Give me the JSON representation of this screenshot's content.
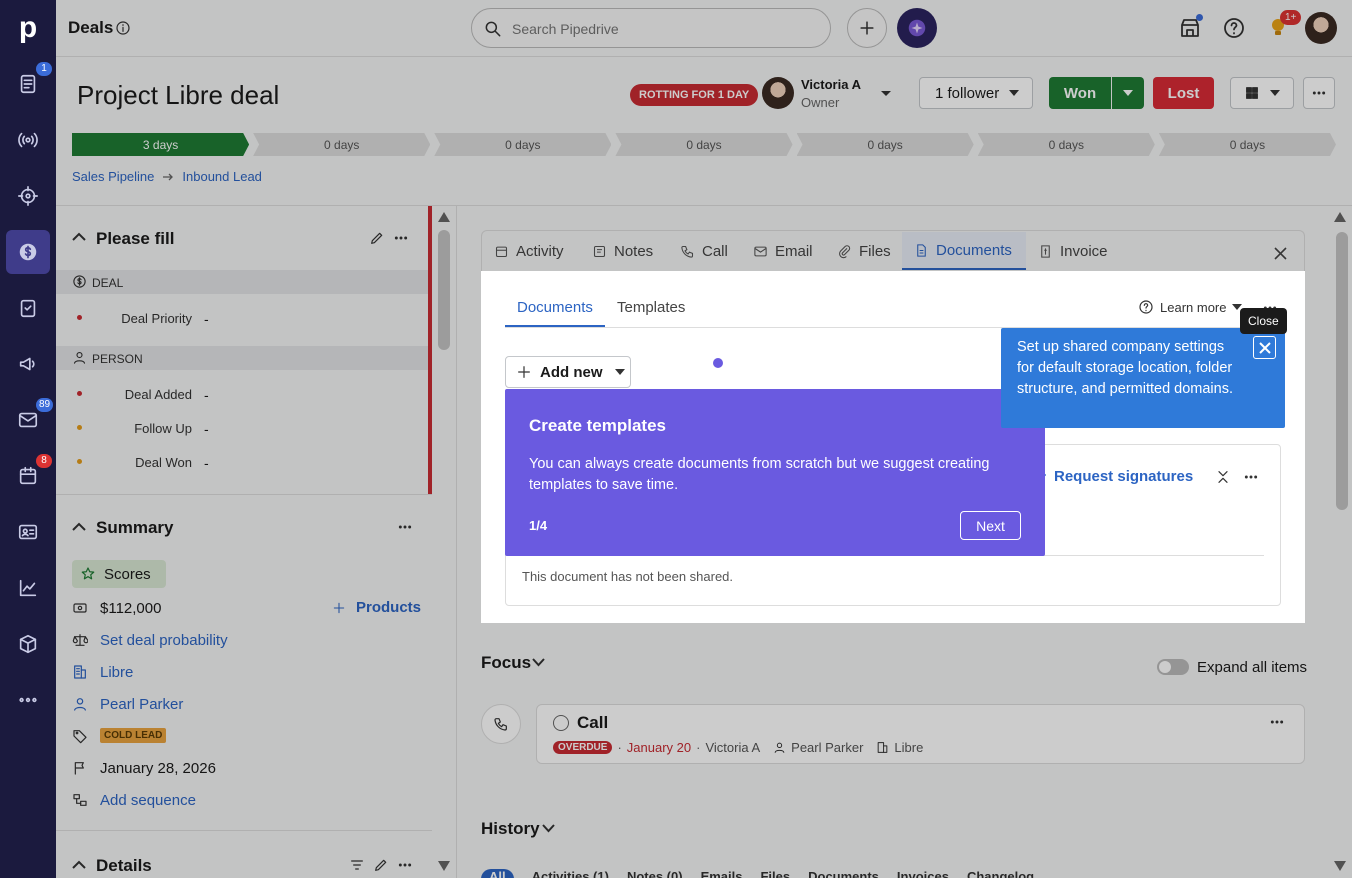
{
  "app": {
    "logo": "p",
    "page_title": "Deals",
    "search_placeholder": "Search Pipedrive",
    "notif_count": "1+"
  },
  "rail": {
    "badges": {
      "leads": "1",
      "mail": "89",
      "activities": "8"
    }
  },
  "deal": {
    "title": "Project Libre deal",
    "rotting": "ROTTING FOR 1 DAY",
    "owner_name": "Victoria A",
    "owner_role": "Owner",
    "followers": "1 follower",
    "won": "Won",
    "lost": "Lost"
  },
  "stages": [
    "3 days",
    "0 days",
    "0 days",
    "0 days",
    "0 days",
    "0 days",
    "0 days"
  ],
  "breadcrumb": {
    "pipeline": "Sales Pipeline",
    "stage": "Inbound Lead"
  },
  "please_fill": {
    "title": "Please fill",
    "deal_header": "DEAL",
    "person_header": "PERSON",
    "fields": [
      {
        "label": "Deal Priority",
        "value": "-"
      },
      {
        "label": "Deal Added",
        "value": "-"
      },
      {
        "label": "Follow Up",
        "value": "-"
      },
      {
        "label": "Deal Won",
        "value": "-"
      }
    ]
  },
  "summary": {
    "title": "Summary",
    "scores": "Scores",
    "value": "$112,000",
    "products": "Products",
    "probability": "Set deal probability",
    "org": "Libre",
    "person": "Pearl Parker",
    "label": "COLD LEAD",
    "close_date": "January 28, 2026",
    "sequence": "Add sequence"
  },
  "details": {
    "title": "Details"
  },
  "tabs": [
    "Activity",
    "Notes",
    "Call",
    "Email",
    "Files",
    "Documents",
    "Invoice"
  ],
  "documents": {
    "subtabs": [
      "Documents",
      "Templates"
    ],
    "learn_more": "Learn more",
    "add_new": "Add new",
    "request_signatures": "Request signatures",
    "not_shared": "This document has not been shared."
  },
  "tooltip": {
    "close": "Close"
  },
  "tour": {
    "title": "Create templates",
    "body": "You can always create documents from scratch but we suggest creating templates to save time.",
    "step": "1/4",
    "next": "Next"
  },
  "hint": {
    "text": "Set up shared company settings for default storage location, folder structure, and permitted domains."
  },
  "focus": {
    "title": "Focus",
    "expand": "Expand all items",
    "activity": {
      "title": "Call",
      "overdue": "OVERDUE",
      "date": "January 20",
      "owner": "Victoria A",
      "person": "Pearl Parker",
      "org": "Libre"
    }
  },
  "history": {
    "title": "History",
    "filters": [
      "All",
      "Activities (1)",
      "Notes (0)",
      "Emails",
      "Files",
      "Documents",
      "Invoices",
      "Changelog"
    ]
  },
  "colors": {
    "accent": "#6a5ae0",
    "won": "#1e7b34",
    "lost": "#d92b36",
    "stage_done": "#1e7b34",
    "hint_blue": "#2f7ad9"
  }
}
